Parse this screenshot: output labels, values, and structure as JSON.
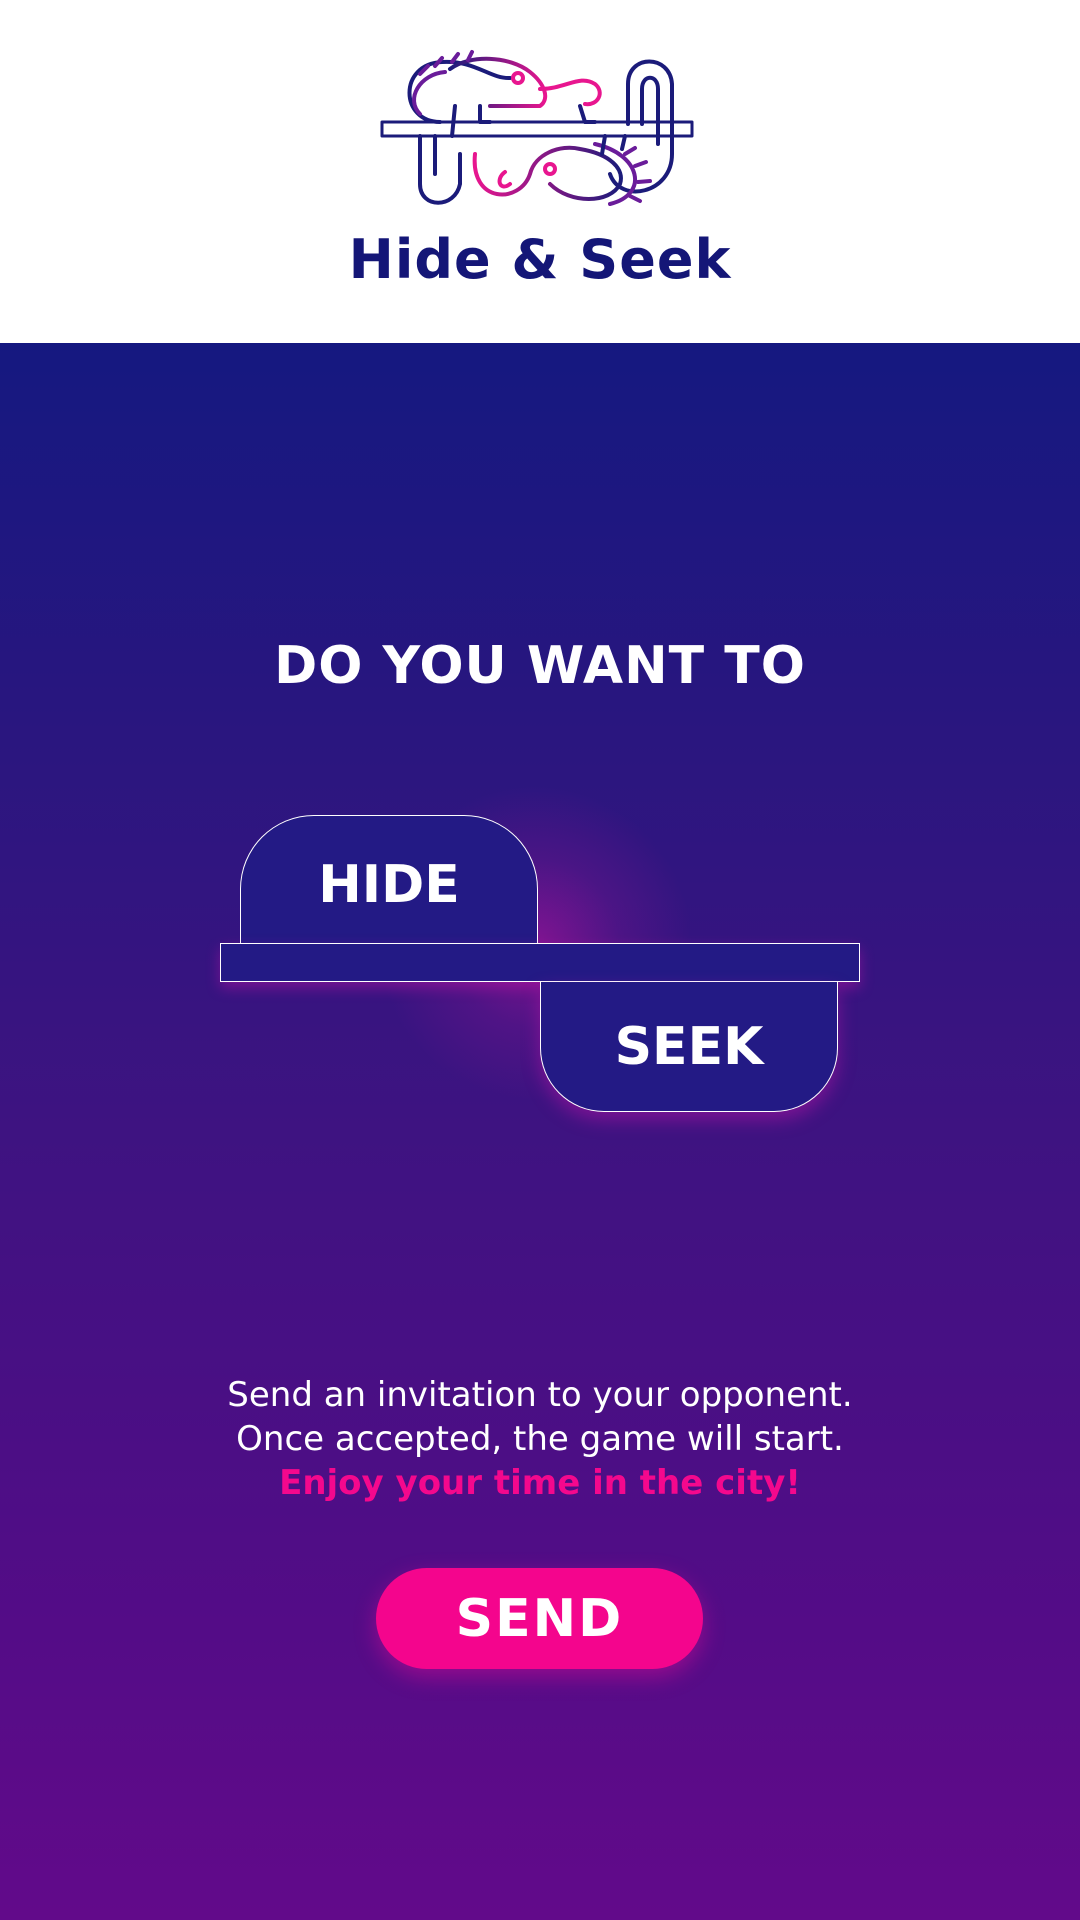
{
  "header": {
    "logo_icon": "chameleons-logo-icon",
    "title": "Hide & Seek"
  },
  "main": {
    "question": "DO YOU WANT TO",
    "choices": {
      "hide": "HIDE",
      "seek": "SEEK"
    },
    "info": {
      "line1": "Send an invitation to your opponent.",
      "line2": "Once accepted, the game will start.",
      "line3": "Enjoy your time in the city!"
    },
    "send_label": "SEND"
  },
  "colors": {
    "brand_navy": "#141677",
    "accent_pink": "#f4058d",
    "gradient_top": "#151880",
    "gradient_bottom": "#620a8a",
    "choice_fill": "#231a85"
  }
}
